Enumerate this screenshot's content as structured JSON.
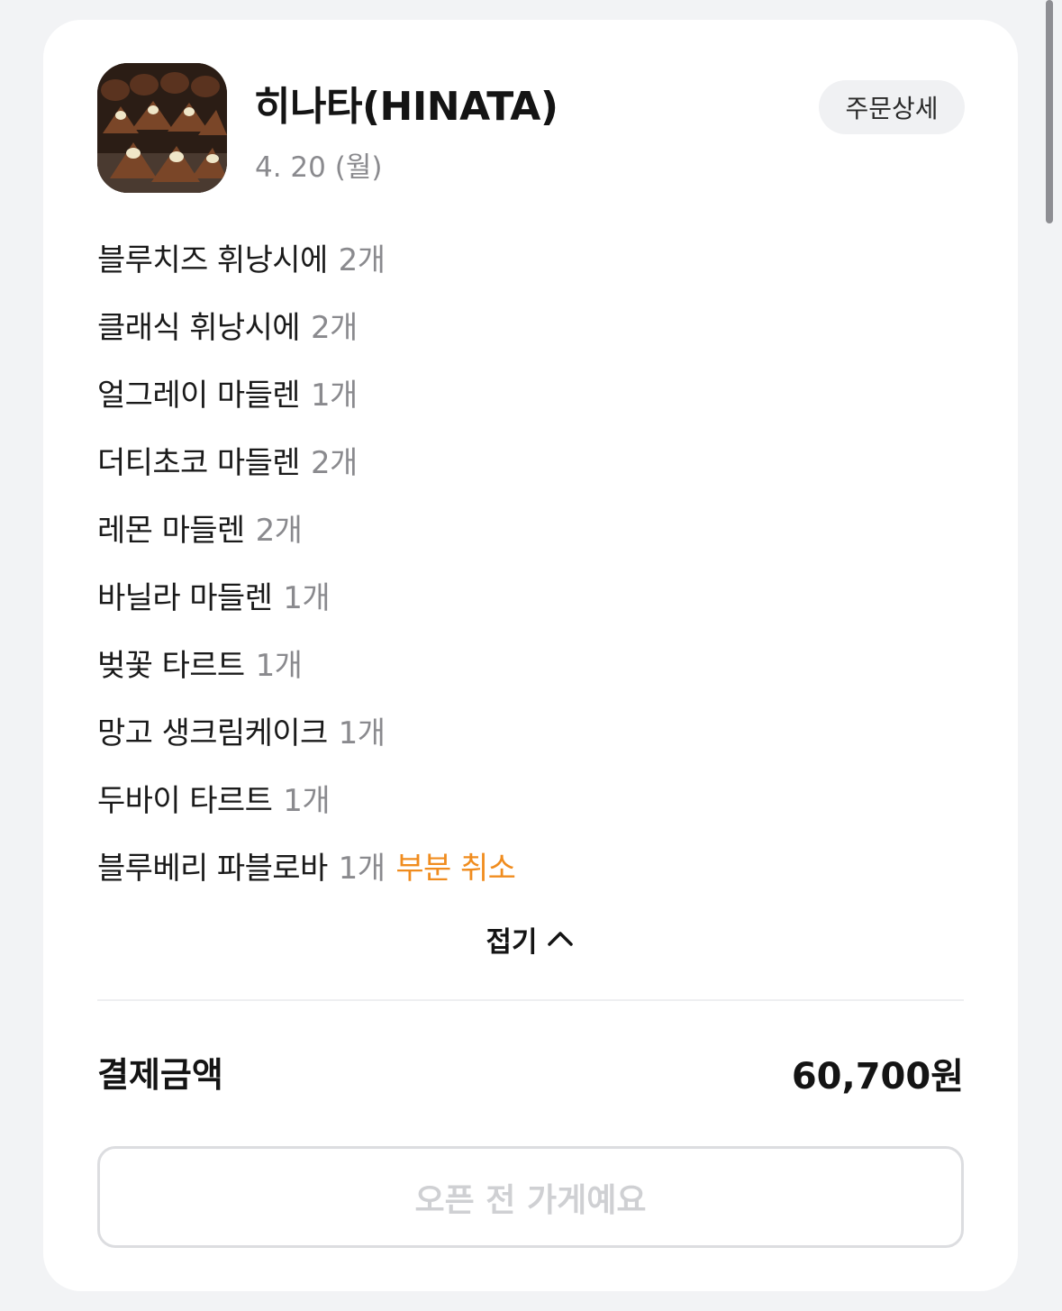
{
  "store": {
    "name": "히나타(HINATA)",
    "date": "4. 20 (월)",
    "detail_button": "주문상세"
  },
  "items": [
    {
      "name": "블루치즈 휘낭시에",
      "qty": "2개",
      "status": ""
    },
    {
      "name": "클래식 휘낭시에",
      "qty": "2개",
      "status": ""
    },
    {
      "name": "얼그레이 마들렌",
      "qty": "1개",
      "status": ""
    },
    {
      "name": "더티초코 마들렌",
      "qty": "2개",
      "status": ""
    },
    {
      "name": "레몬 마들렌",
      "qty": "2개",
      "status": ""
    },
    {
      "name": "바닐라 마들렌",
      "qty": "1개",
      "status": ""
    },
    {
      "name": "벚꽃 타르트",
      "qty": "1개",
      "status": ""
    },
    {
      "name": "망고 생크림케이크",
      "qty": "1개",
      "status": ""
    },
    {
      "name": "두바이 타르트",
      "qty": "1개",
      "status": ""
    },
    {
      "name": "블루베리 파블로바",
      "qty": "1개",
      "status": "부분 취소"
    }
  ],
  "collapse_label": "접기",
  "payment": {
    "label": "결제금액",
    "amount": "60,700원"
  },
  "action_button": "오픈 전 가게예요",
  "colors": {
    "cancel_accent": "#f08c1e",
    "muted_text": "#8a8a8e"
  },
  "icons": {
    "collapse": "chevron-up-icon"
  }
}
